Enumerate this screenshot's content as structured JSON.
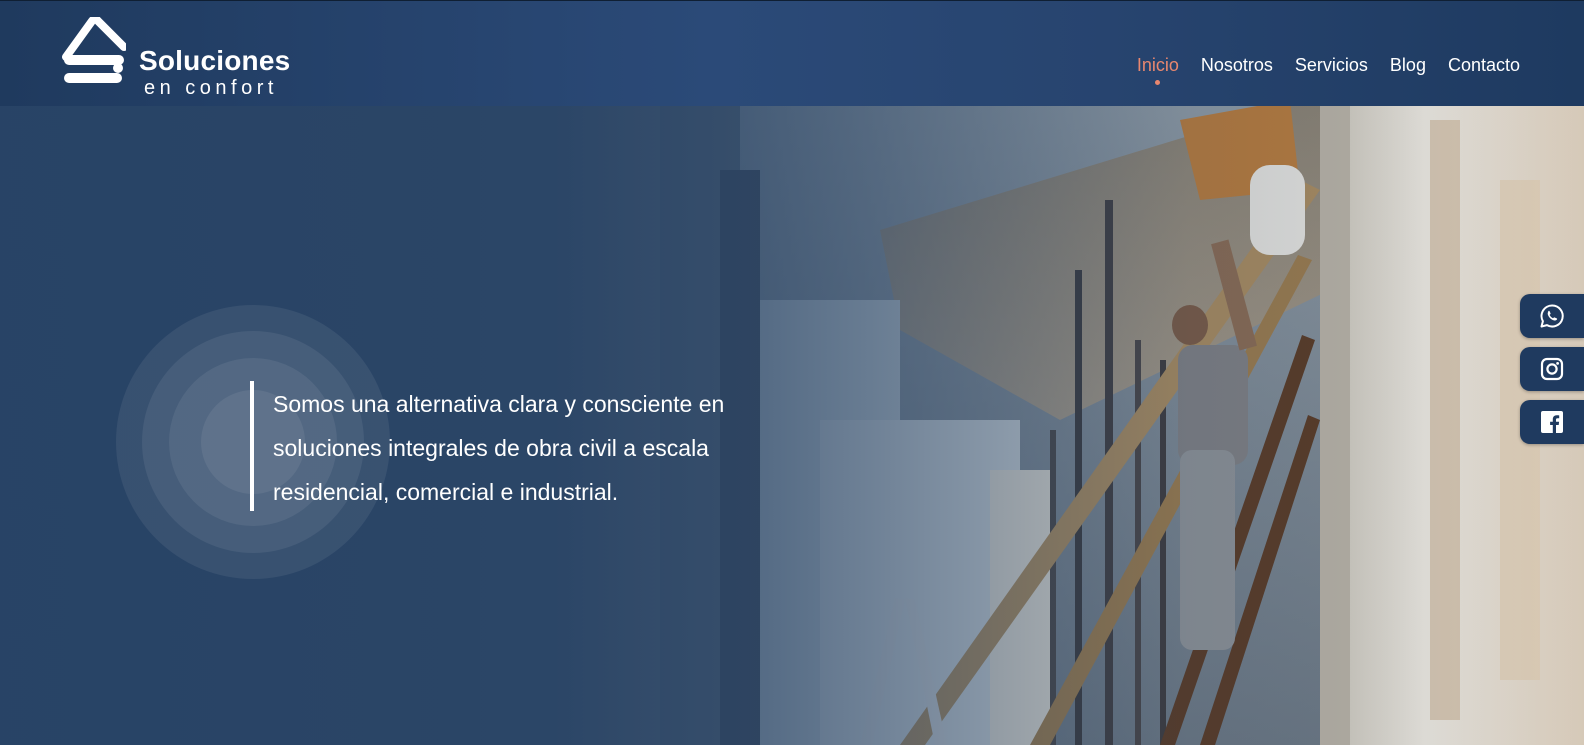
{
  "brand": {
    "title": "Soluciones",
    "subtitle": "en confort"
  },
  "nav": {
    "items": [
      {
        "label": "Inicio",
        "active": true
      },
      {
        "label": "Nosotros",
        "active": false
      },
      {
        "label": "Servicios",
        "active": false
      },
      {
        "label": "Blog",
        "active": false
      },
      {
        "label": "Contacto",
        "active": false
      }
    ]
  },
  "hero": {
    "text": "Somos una alternativa clara y consciente en soluciones integrales de obra civil a escala residencial, comercial e industrial."
  },
  "social": {
    "icons": [
      "whatsapp-icon",
      "instagram-icon",
      "facebook-icon"
    ]
  },
  "colors": {
    "primary": "#2a4566",
    "header": "#27446f",
    "accent": "#e8876f",
    "text": "#ffffff"
  }
}
